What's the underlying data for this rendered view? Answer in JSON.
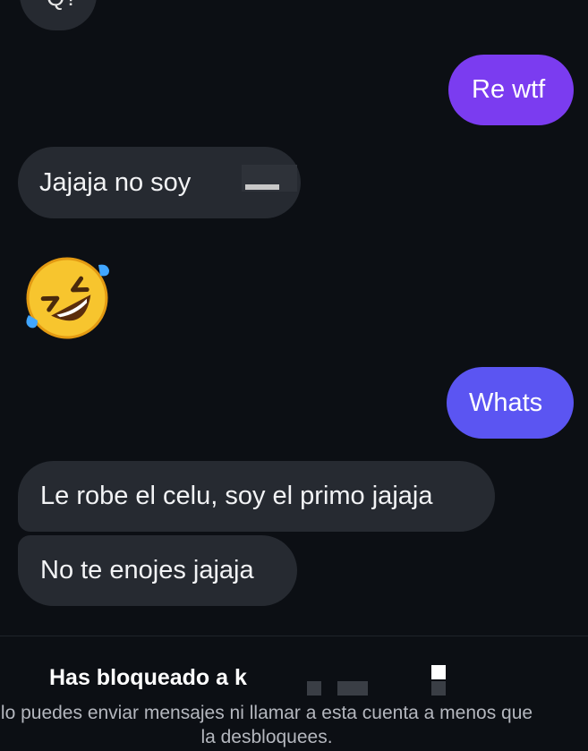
{
  "conversation": {
    "top_partial_text": "Q?",
    "messages": [
      {
        "text": "Re wtf"
      },
      {
        "text": "Jajaja no soy"
      },
      {
        "emoji": "🤣"
      },
      {
        "text": "Whats"
      },
      {
        "text": "Le robe el celu, soy el primo jajaja"
      },
      {
        "text": "No te enojes jajaja"
      }
    ]
  },
  "footer": {
    "blocked_title": "Has bloqueado a k",
    "blocked_desc": "lo puedes enviar mensajes ni llamar a esta cuenta a menos que la desbloquees."
  },
  "colors": {
    "background": "#0c0f14",
    "incoming_bubble": "#262a31",
    "outgoing_top": "#7b3cf0",
    "outgoing_bottom": "#5b55f2"
  }
}
